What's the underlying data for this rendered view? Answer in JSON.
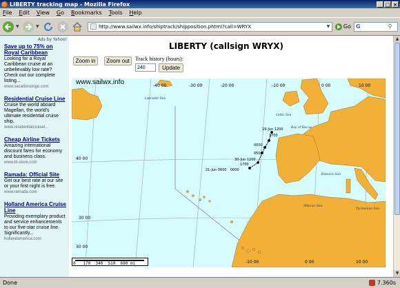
{
  "window": {
    "title": "LIBERTY tracking map - Mozilla Firefox",
    "controls": [
      "_",
      "□",
      "×"
    ]
  },
  "menu": [
    "File",
    "Edit",
    "View",
    "Go",
    "Bookmarks",
    "Tools",
    "Help"
  ],
  "toolbar": {
    "url": "http://www.sailwx.info/shiptrack/shipposition.phtml?call=WRYX",
    "go_label": "Go",
    "search_label": "G"
  },
  "sidebar": {
    "ads_by": "Ads by Yahoo!",
    "ads": [
      {
        "title": "Save up to 75% on Royal Caribbean",
        "body": "Looking for a Royal Caribbean cruise at an unbelievably low rate? Check out our complete listing...",
        "url": "www.vacationstogo.com"
      },
      {
        "title": "Residential Cruise Line",
        "body": "Cruise the world aboard Magellan, the world's ultimate residential cruise ship.",
        "url": "www.residentialcruisel..."
      },
      {
        "title": "Cheap Airline Tickets",
        "body": "Amazing international discount fares for economy and business class.",
        "url": "www.bt-store.com"
      },
      {
        "title": "Ramada: Official Site",
        "body": "Get our best rate at our site or your first night is free.",
        "url": "www.ramada.com"
      },
      {
        "title": "Holland America Cruise Line",
        "body": "Providing exemplary product and service enhancements to our five-star cruise line. Significantly...",
        "url": "hollandamerica.com"
      }
    ]
  },
  "main": {
    "heading": "LIBERTY (callsign WRYX)",
    "zoom_in": "Zoom in",
    "zoom_out": "Zoom out",
    "track_label": "Track history (hours):",
    "track_value": "240",
    "update": "Update"
  },
  "map": {
    "watermark": "www.sailwx.info",
    "sea_color": "#d6fbfc",
    "land_color": "#f2b136",
    "track_color": "#000000",
    "lon_labels_top": [
      "-40 00",
      "-30 00",
      "-20 00",
      "-10 00",
      "0 00",
      "10 00"
    ],
    "lon_labels_bottom": [
      "-10 00",
      "0 00",
      "10 00"
    ],
    "lat_labels": [
      "40 00",
      "30 00",
      "30 00"
    ],
    "place_labels": [
      "Celtic Sea",
      "Bay of Biscay",
      "Balearic Sea",
      "Tyrrhenian Sea",
      "Alboran Sea",
      "Labrador Sea"
    ],
    "track_points": [
      {
        "label": "19-Jun 1200"
      },
      {
        "label": "1700"
      },
      {
        "label": "0000"
      },
      {
        "label": "0500"
      },
      {
        "label": "30-Jun 1200"
      },
      {
        "label": "1700"
      },
      {
        "label": "0000"
      },
      {
        "label": "21-Jun 0600"
      }
    ],
    "scale_labels": "0   170  340  510  680 mi"
  },
  "status": {
    "text": "Done",
    "time": "7.360s"
  }
}
